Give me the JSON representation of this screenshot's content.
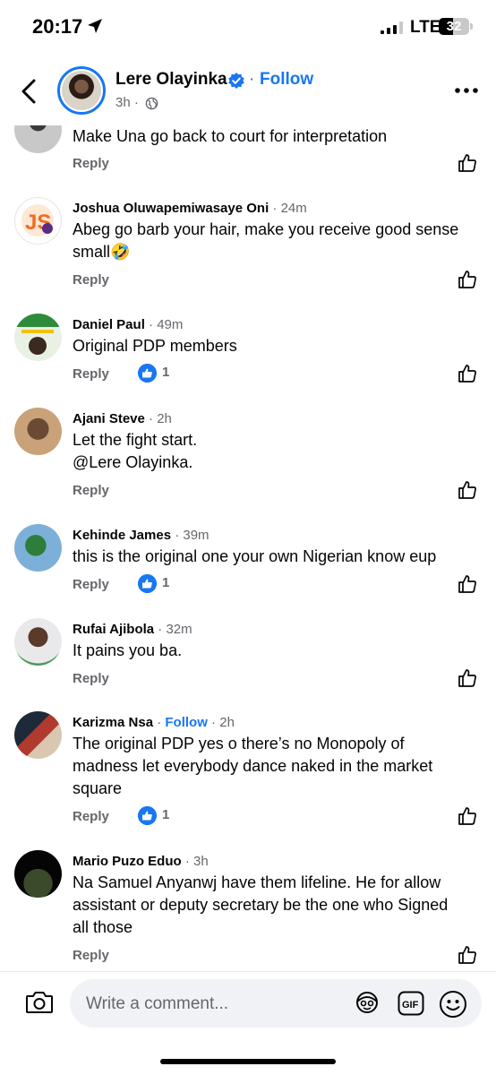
{
  "status_bar": {
    "time": "20:17",
    "network": "LTE",
    "battery": "32"
  },
  "header": {
    "author": "Lere Olayinka",
    "dot": "·",
    "follow": "Follow",
    "time": "3h ·"
  },
  "comments": [
    {
      "name": "",
      "meta": "",
      "follow": "",
      "text": "Make Una go back to court for interpretation",
      "reply": "Reply",
      "reactions": ""
    },
    {
      "name": "Joshua Oluwapemiwasaye Oni",
      "meta": " · 24m",
      "follow": "",
      "text": "Abeg go barb your hair, make you receive good sense small🤣",
      "reply": "Reply",
      "reactions": ""
    },
    {
      "name": "Daniel Paul",
      "meta": " · 49m",
      "follow": "",
      "text": "Original PDP members",
      "reply": "Reply",
      "reactions": "1"
    },
    {
      "name": "Ajani Steve",
      "meta": " · 2h",
      "follow": "",
      "text": "Let the fight start.\n@Lere Olayinka.",
      "reply": "Reply",
      "reactions": ""
    },
    {
      "name": "Kehinde James",
      "meta": " · 39m",
      "follow": "",
      "text": "this is the original one your own Nigerian know eup",
      "reply": "Reply",
      "reactions": "1"
    },
    {
      "name": "Rufai Ajibola",
      "meta": " · 32m",
      "follow": "",
      "text": "It pains you ba.",
      "reply": "Reply",
      "reactions": ""
    },
    {
      "name": "Karizma Nsa",
      "meta": " · 2h",
      "follow": "Follow",
      "text": "The original PDP yes o there’s no Monopoly of madness let everybody dance naked in the market square",
      "reply": "Reply",
      "reactions": "1"
    },
    {
      "name": "Mario Puzo Eduo",
      "meta": " · 3h",
      "follow": "",
      "text": "Na Samuel Anyanwj have them lifeline. He for allow assistant or deputy secretary be the one who Signed all those",
      "reply": "Reply",
      "reactions": ""
    }
  ],
  "composer": {
    "placeholder": "Write a comment..."
  },
  "colors": {
    "accent": "#1877f2",
    "secondary_text": "#65676b",
    "input_bg": "#f0f2f5"
  }
}
